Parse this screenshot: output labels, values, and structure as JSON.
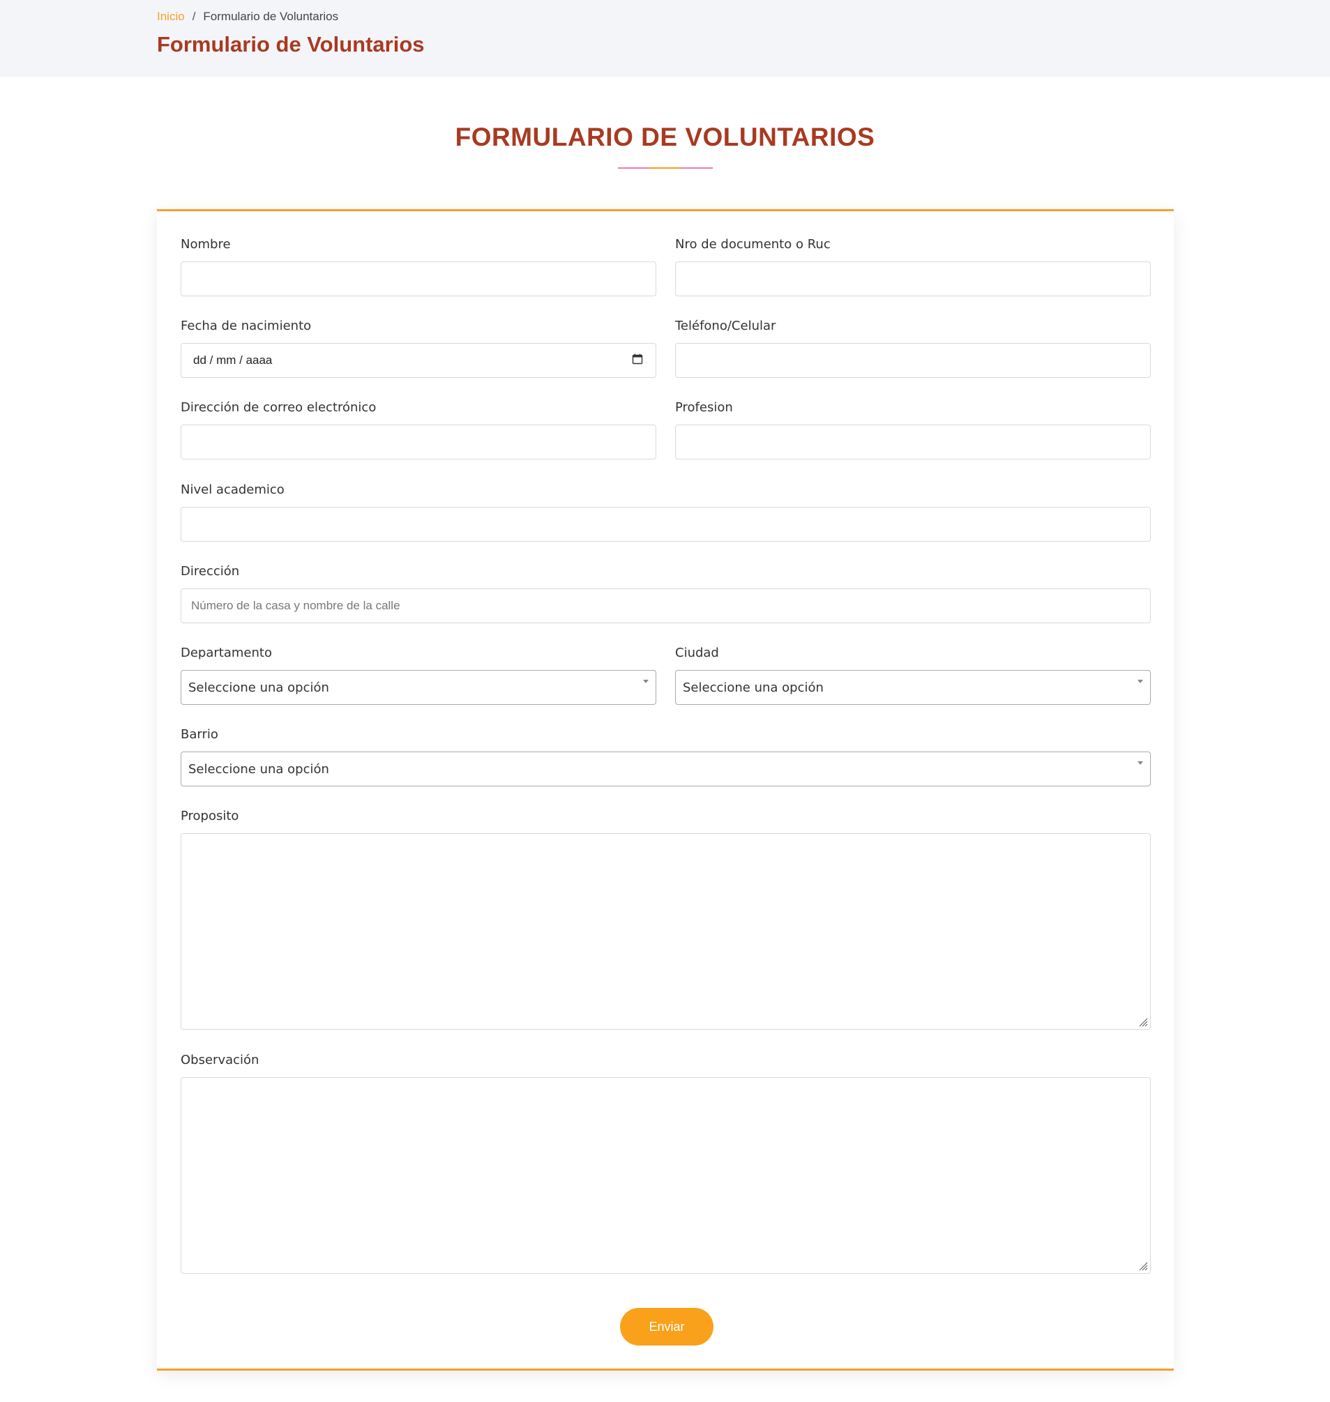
{
  "breadcrumb": {
    "home": "Inicio",
    "separator": "/",
    "current": "Formulario de Voluntarios"
  },
  "header": {
    "title": "Formulario de Voluntarios"
  },
  "section": {
    "title": "FORMULARIO DE VOLUNTARIOS"
  },
  "form": {
    "nombre": {
      "label": "Nombre",
      "value": ""
    },
    "documento": {
      "label": "Nro de documento o Ruc",
      "value": ""
    },
    "fecha": {
      "label": "Fecha de nacimiento",
      "value": "dd / mm / aaaa"
    },
    "telefono": {
      "label": "Teléfono/Celular",
      "value": ""
    },
    "correo": {
      "label": "Dirección de correo electrónico",
      "value": ""
    },
    "profesion": {
      "label": "Profesion",
      "value": ""
    },
    "nivel": {
      "label": "Nivel academico",
      "value": ""
    },
    "direccion": {
      "label": "Dirección",
      "placeholder": "Número de la casa y nombre de la calle"
    },
    "departamento": {
      "label": "Departamento",
      "selected": "Seleccione una opción"
    },
    "ciudad": {
      "label": "Ciudad",
      "selected": "Seleccione una opción"
    },
    "barrio": {
      "label": "Barrio",
      "selected": "Seleccione una opción"
    },
    "proposito": {
      "label": "Proposito",
      "value": ""
    },
    "observacion": {
      "label": "Observación",
      "value": ""
    },
    "submit_label": "Enviar"
  },
  "colors": {
    "accent": "#f7a02a",
    "title": "#a83a20",
    "divider_side": "#f07aa7"
  },
  "icons": {
    "date": "calendar-icon",
    "select": "chevron-down-icon",
    "textarea": "resize-grip-icon"
  }
}
